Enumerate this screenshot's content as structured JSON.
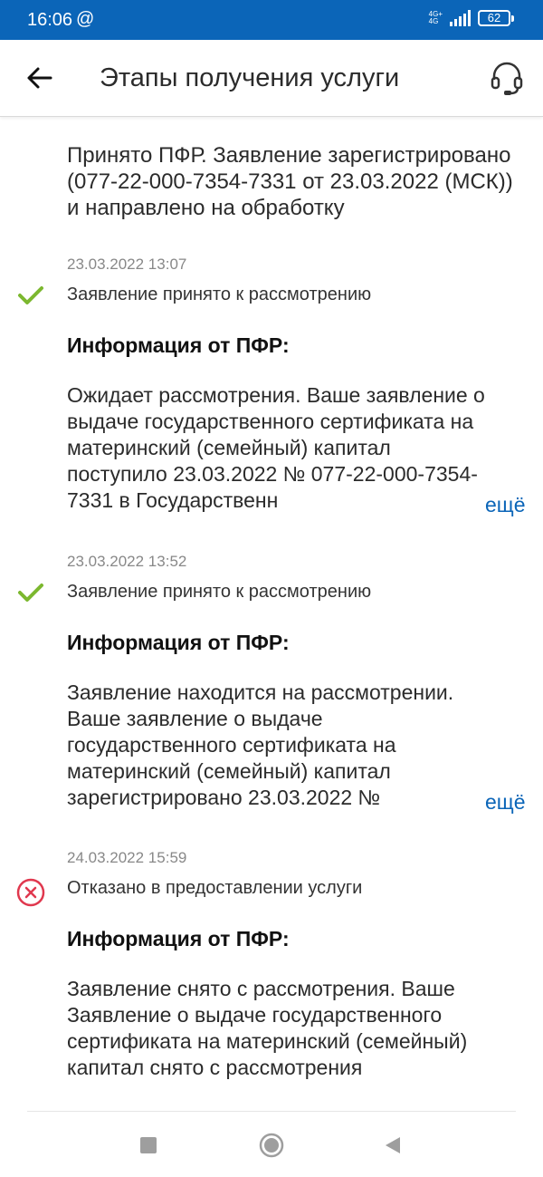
{
  "status_bar": {
    "time": "16:06",
    "at_symbol": "@",
    "network_top": "4G+",
    "network_bottom": "4G",
    "battery": "62"
  },
  "app_bar": {
    "back_icon": "arrow-left-icon",
    "title": "Этапы получения услуги",
    "support_icon": "headset-icon"
  },
  "intro": {
    "text": "Принято ПФР. Заявление зарегистрировано (077-22-000-7354-7331 от 23.03.2022 (МСК)) и направлено на обработку"
  },
  "stages": [
    {
      "date": "23.03.2022 13:07",
      "icon": "check-icon",
      "status": "Заявление принято к рассмотрению",
      "info_title": "Информация от ПФР:",
      "text": "Ожидает рассмотрения. Ваше заявление о выдаче государственного сертификата на материнский (семейный) капитал поступило 23.03.2022 № 077-22-000-7354-7331 в Государственн",
      "more": "ещё"
    },
    {
      "date": "23.03.2022 13:52",
      "icon": "check-icon",
      "status": "Заявление принято к рассмотрению",
      "info_title": "Информация от ПФР:",
      "text": "Заявление находится на рассмотрении. Ваше заявление о выдаче государственного сертификата на материнский (семейный) капитал зарегистрировано 23.03.2022 №",
      "more": "ещё"
    },
    {
      "date": "24.03.2022 15:59",
      "icon": "cross-circle-icon",
      "status": "Отказано в предоставлении услуги",
      "info_title": "Информация от ПФР:",
      "text": "Заявление снято с рассмотрения. Ваше Заявление о выдаче государственного сертификата на материнский (семейный) капитал снято с рассмотрения"
    }
  ],
  "colors": {
    "brand": "#0b65b8",
    "success": "#7cb82f",
    "error": "#e0384e"
  },
  "nav_bar": {
    "recents_icon": "square-icon",
    "home_icon": "circle-icon",
    "back_icon": "triangle-back-icon"
  }
}
